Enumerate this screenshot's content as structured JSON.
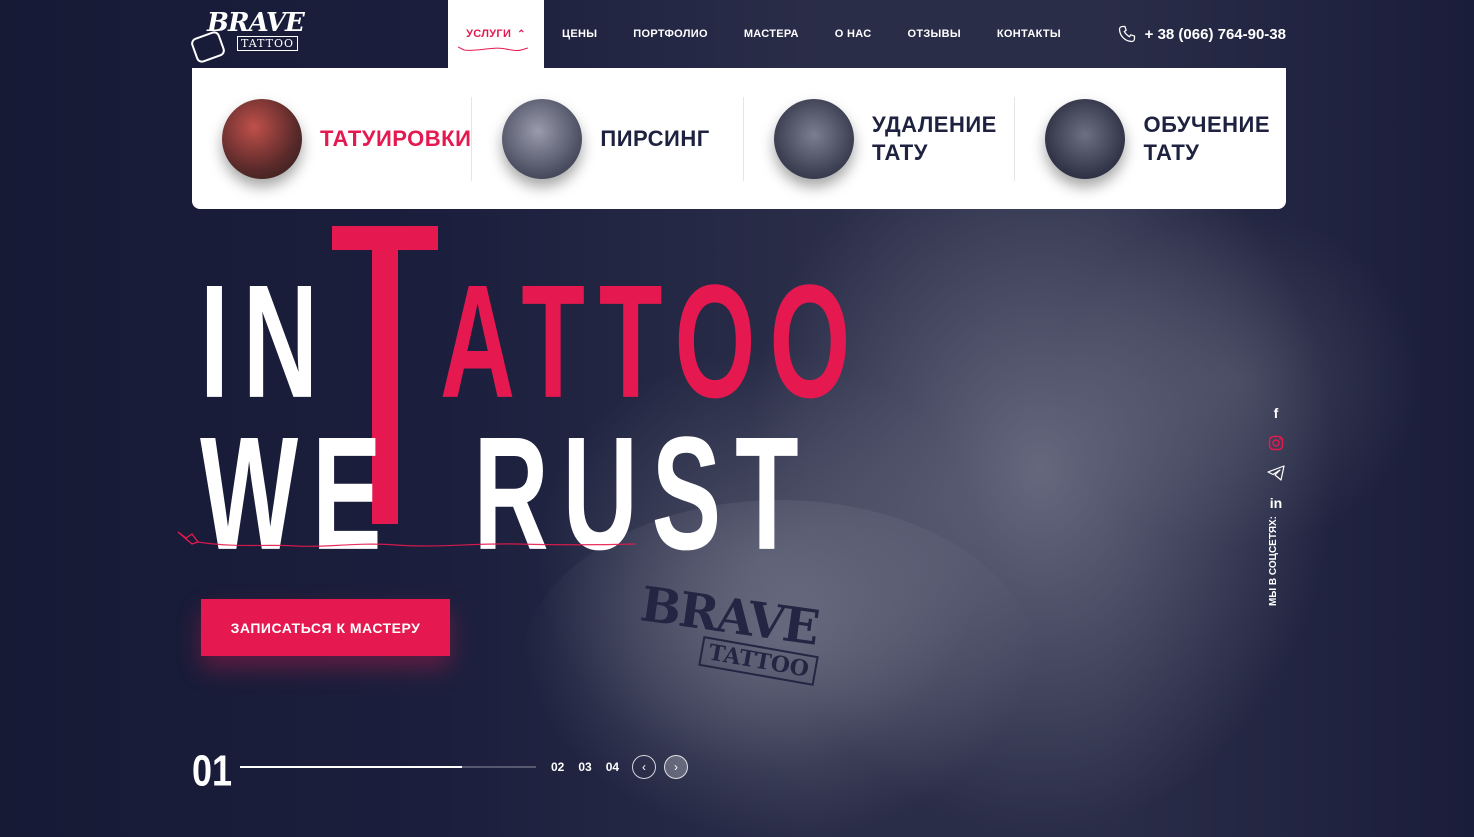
{
  "brand": {
    "name": "BRAVE",
    "sub": "TATTOO"
  },
  "nav": {
    "items": [
      {
        "label": "УСЛУГИ",
        "active": true
      },
      {
        "label": "ЦЕНЫ"
      },
      {
        "label": "ПОРТФОЛИО"
      },
      {
        "label": "МАСТЕРА"
      },
      {
        "label": "О НАС"
      },
      {
        "label": "ОТЗЫВЫ"
      },
      {
        "label": "КОНТАКТЫ"
      }
    ]
  },
  "phone": "+ 38 (066) 764-90-38",
  "services": [
    {
      "label": "ТАТУИРОВКИ",
      "active": true,
      "thumb_color": "#7a3a3a"
    },
    {
      "label": "ПИРСИНГ",
      "thumb_color": "#6b6e80"
    },
    {
      "label": "УДАЛЕНИЕ ТАТУ",
      "line1": "УДАЛЕНИЕ",
      "line2": "ТАТУ",
      "thumb_color": "#4a4d62"
    },
    {
      "label": "ОБУЧЕНИЕ ТАТУ",
      "line1": "ОБУЧЕНИЕ",
      "line2": "ТАТУ",
      "thumb_color": "#3e4156"
    }
  ],
  "hero": {
    "line1_white": "IN",
    "line1_red": "TATTOO",
    "line1_red_visible": "ATTOO",
    "line2_white": "WE",
    "line2_rest": "RUST",
    "line2_full": "TRUST"
  },
  "cta": "ЗАПИСАТЬСЯ К МАСТЕРУ",
  "slider": {
    "current": "01",
    "others": [
      "02",
      "03",
      "04"
    ],
    "progress": 0.75,
    "prev_icon": "chevron-left-icon",
    "next_icon": "chevron-right-icon"
  },
  "socials": {
    "label": "МЫ В СОЦСЕТЯХ:",
    "items": [
      "facebook-icon",
      "instagram-icon",
      "telegram-icon",
      "linkedin-icon"
    ]
  },
  "colors": {
    "accent": "#e5194f",
    "bg": "#161a35",
    "panel": "#ffffff",
    "text_dark": "#1e2240"
  },
  "background_tattoo": {
    "line1": "BRAVE",
    "line2": "TATTOO"
  }
}
